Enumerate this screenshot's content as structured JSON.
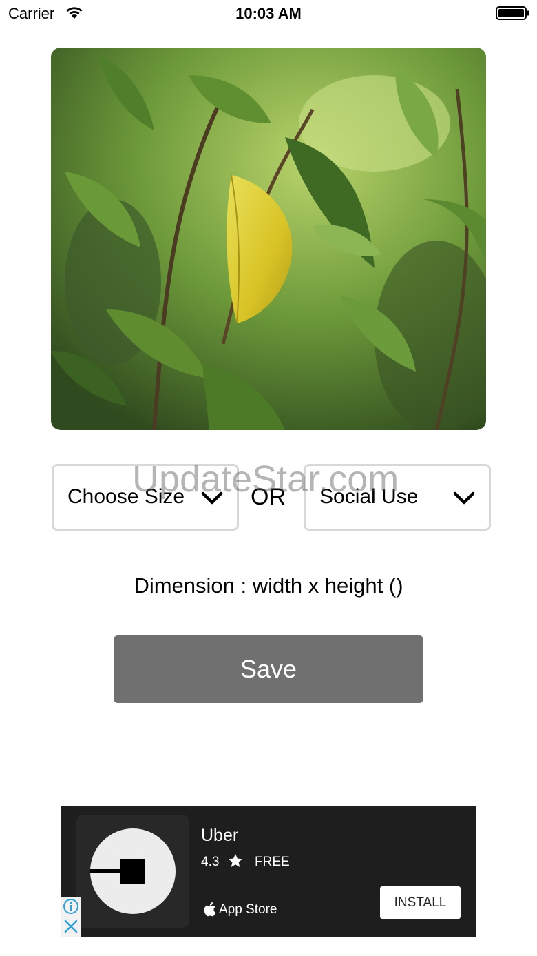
{
  "status_bar": {
    "carrier": "Carrier",
    "time": "10:03 AM"
  },
  "photo": {
    "description_icon": "leaf-photo"
  },
  "controls": {
    "size_select_label": "Choose Size",
    "or_label": "OR",
    "social_select_label": "Social Use",
    "dimension_text": "Dimension : width x  height ()",
    "save_label": "Save"
  },
  "watermark": "UpdateStar.com",
  "ad": {
    "app_name": "Uber",
    "rating": "4.3",
    "price": "FREE",
    "store_label": "App Store",
    "install_label": "INSTALL"
  },
  "colors": {
    "save_button": "#707070",
    "ad_background": "#1e1e1e",
    "select_border": "#d8d8d8",
    "adchoices_icon": "#2a9fd8"
  }
}
